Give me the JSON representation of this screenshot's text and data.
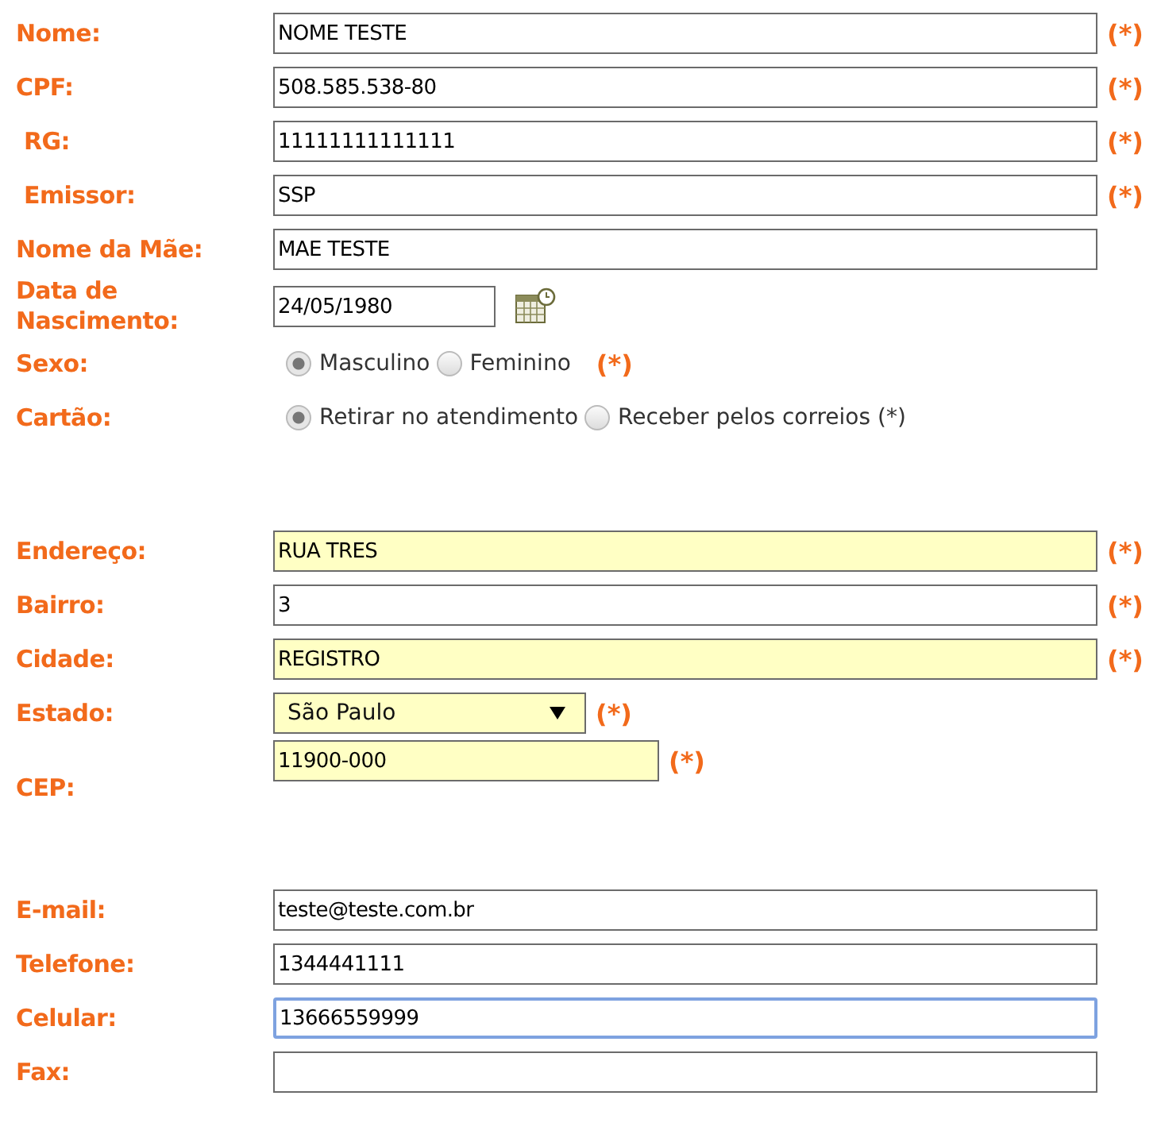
{
  "sections": [
    {
      "rows": [
        {
          "kind": "text",
          "label": "Nome:",
          "value": "NOME TESTE",
          "highlighted": false,
          "focused": false,
          "required": "(*)"
        },
        {
          "kind": "text",
          "label": "CPF:",
          "value": "508.585.538-80",
          "highlighted": false,
          "focused": false,
          "required": "(*)"
        },
        {
          "kind": "text",
          "label": "RG:",
          "value": "11111111111111",
          "highlighted": false,
          "focused": false,
          "required": "(*)",
          "indented": true
        },
        {
          "kind": "text",
          "label": "Emissor:",
          "value": "SSP",
          "highlighted": false,
          "focused": false,
          "required": "(*)",
          "indented": true
        },
        {
          "kind": "text",
          "label": "Nome da Mãe:",
          "value": "MAE TESTE",
          "highlighted": false,
          "focused": false
        },
        {
          "kind": "date",
          "label": "Data de Nascimento:",
          "value": "24/05/1980"
        },
        {
          "kind": "radio",
          "label": "Sexo:",
          "options": [
            {
              "label": "Masculino",
              "selected": true
            },
            {
              "label": "Feminino",
              "selected": false
            }
          ],
          "required": "(*)"
        },
        {
          "kind": "radio",
          "label": "Cartão:",
          "options": [
            {
              "label": "Retirar no atendimento",
              "selected": true
            },
            {
              "label": "Receber pelos correios (*)",
              "selected": false
            }
          ]
        }
      ]
    },
    {
      "rows": [
        {
          "kind": "text",
          "label": "Endereço:",
          "value": "RUA TRES",
          "highlighted": true,
          "focused": false,
          "required": "(*)"
        },
        {
          "kind": "text",
          "label": "Bairro:",
          "value": "3",
          "highlighted": false,
          "focused": false,
          "required": "(*)"
        },
        {
          "kind": "text",
          "label": "Cidade:",
          "value": "REGISTRO",
          "highlighted": true,
          "focused": false,
          "required": "(*)"
        },
        {
          "kind": "select",
          "label": "Estado:",
          "value": "São Paulo",
          "highlighted": true,
          "required": "(*)"
        },
        {
          "kind": "short",
          "label": "CEP:",
          "value": "11900-000",
          "highlighted": true,
          "focused": false,
          "required": "(*)"
        }
      ]
    },
    {
      "rows": [
        {
          "kind": "text",
          "label": "E-mail:",
          "value": "teste@teste.com.br",
          "highlighted": false,
          "focused": false
        },
        {
          "kind": "text",
          "label": "Telefone:",
          "value": "1344441111",
          "highlighted": false,
          "focused": false
        },
        {
          "kind": "text",
          "label": "Celular:",
          "value": "13666559999",
          "highlighted": false,
          "focused": true
        },
        {
          "kind": "text",
          "label": "Fax:",
          "value": "",
          "highlighted": false,
          "focused": false
        }
      ]
    }
  ]
}
